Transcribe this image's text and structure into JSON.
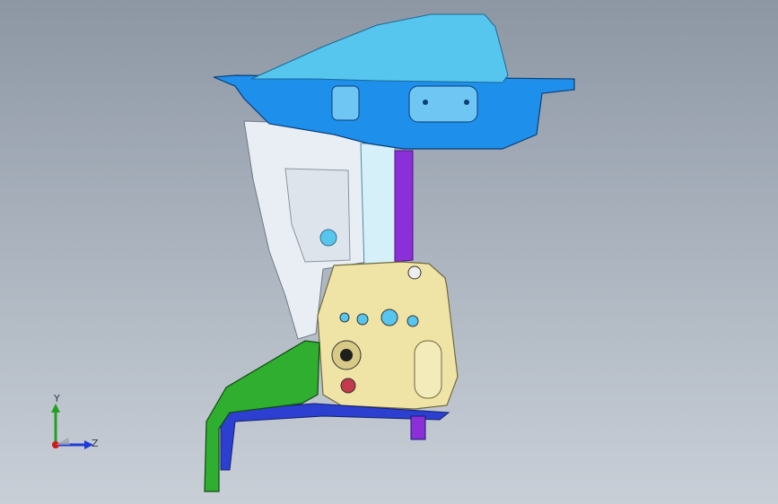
{
  "viewport": {
    "background_top": "#8d97a4",
    "background_bottom": "#c9cfd7"
  },
  "model": {
    "parts": [
      {
        "name": "upper-tray",
        "color": "#1e8fea"
      },
      {
        "name": "tray-top-cover",
        "color": "#56c6ee"
      },
      {
        "name": "side-panel",
        "color": "#e9eef4"
      },
      {
        "name": "vertical-pillar",
        "color": "#d6f0fa"
      },
      {
        "name": "purple-bracket",
        "color": "#8b2fd8"
      },
      {
        "name": "mount-bracket",
        "color": "#efe4a6"
      },
      {
        "name": "lower-green-arm",
        "color": "#2fae2f"
      },
      {
        "name": "lower-blue-rail",
        "color": "#2c3fd0"
      }
    ]
  },
  "triad": {
    "y_label": "Y",
    "z_label": "Z",
    "y_color": "#22a022",
    "z_color": "#1e3ad8",
    "x_color": "#d01818"
  }
}
